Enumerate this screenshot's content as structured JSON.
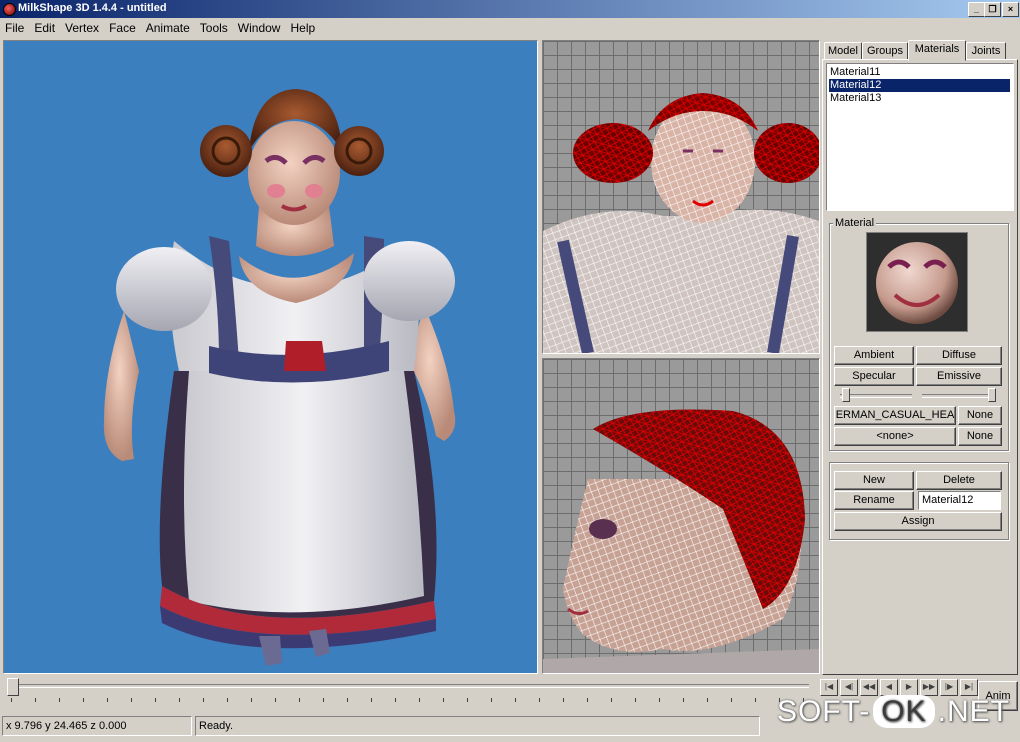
{
  "window": {
    "title": "MilkShape 3D 1.4.4 - untitled",
    "minimize": "_",
    "maximize": "❐",
    "close": "×"
  },
  "menu": [
    "File",
    "Edit",
    "Vertex",
    "Face",
    "Animate",
    "Tools",
    "Window",
    "Help"
  ],
  "tabs": {
    "items": [
      "Model",
      "Groups",
      "Materials",
      "Joints"
    ],
    "active": "Materials"
  },
  "materials": {
    "list": [
      "Material11",
      "Material12",
      "Material13"
    ],
    "selected": "Material12"
  },
  "material_panel": {
    "group_label": "Material",
    "ambient": "Ambient",
    "diffuse": "Diffuse",
    "specular": "Specular",
    "emissive": "Emissive",
    "texture1": "ERMAN_CASUAL_HEA",
    "texture1_none": "None",
    "texture2": "<none>",
    "texture2_none": "None"
  },
  "actions": {
    "new": "New",
    "delete": "Delete",
    "rename": "Rename",
    "name_value": "Material12",
    "assign": "Assign"
  },
  "timeline": {
    "anim": "Anim"
  },
  "status": {
    "coords": "x 9.796 y 24.465 z 0.000",
    "message": "Ready."
  },
  "watermark": {
    "left": "SOFT-",
    "mid": "OK",
    "right": ".NET"
  },
  "colors": {
    "viewport3d_bg": "#3b7fbf",
    "wire_red": "#e00000",
    "wire_white": "#ffffff",
    "selection": "#0a246a"
  }
}
